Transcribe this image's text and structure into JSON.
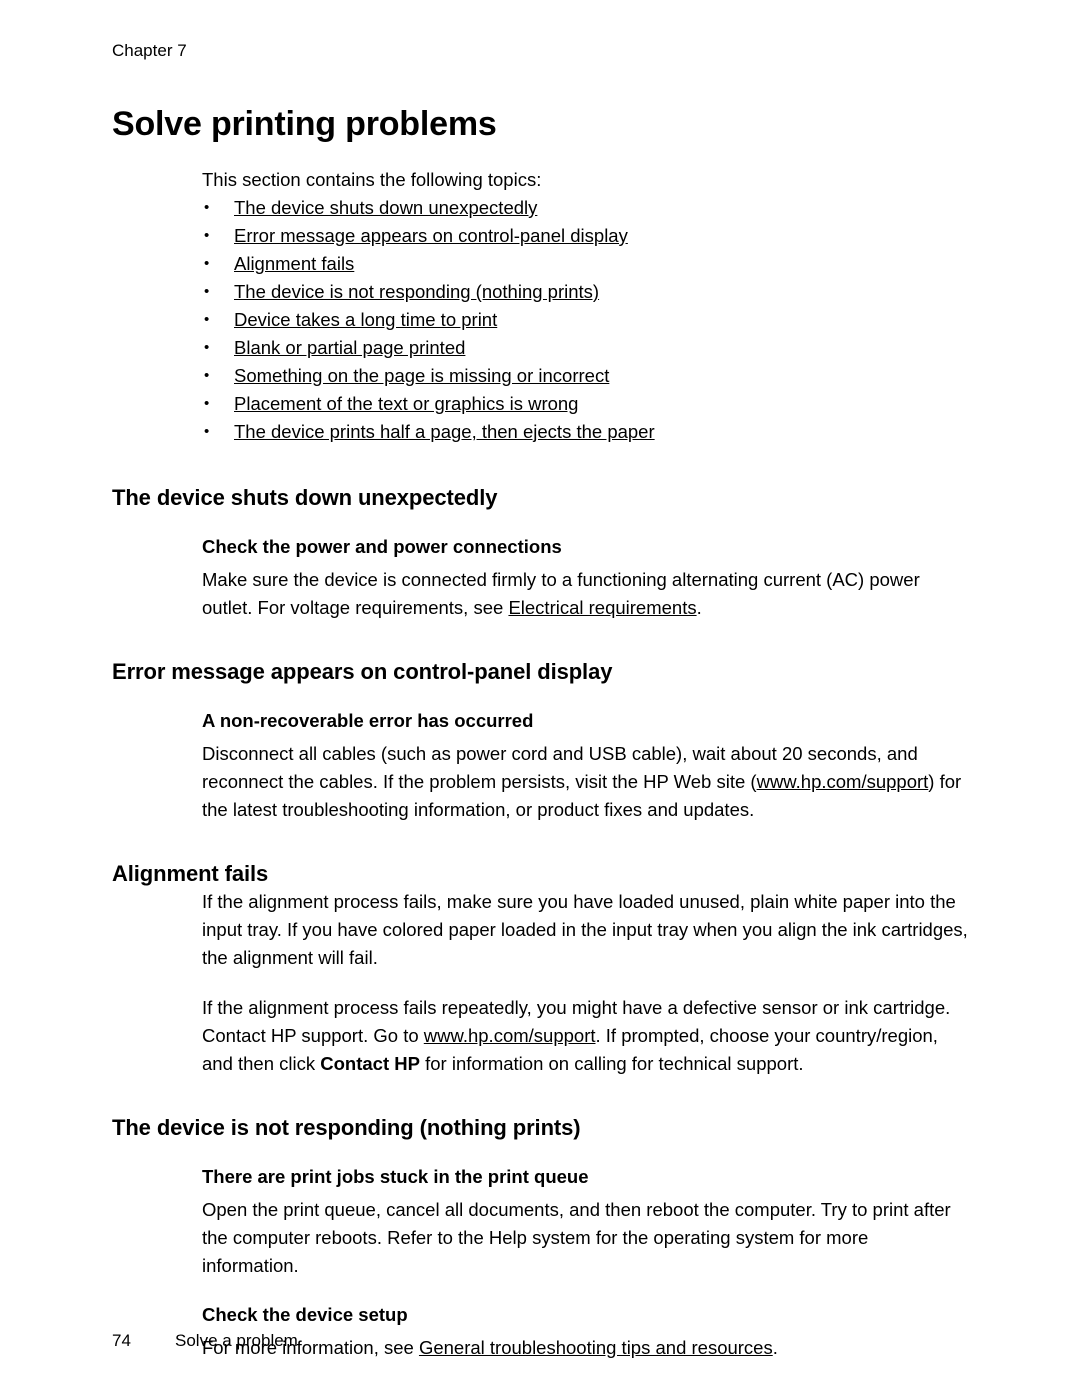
{
  "header": {
    "running_head": "Chapter 7"
  },
  "page": {
    "title": "Solve printing problems",
    "intro": "This section contains the following topics:"
  },
  "toc": {
    "items": [
      "The device shuts down unexpectedly",
      "Error message appears on control-panel display",
      "Alignment fails",
      "The device is not responding (nothing prints)",
      "Device takes a long time to print",
      "Blank or partial page printed",
      "Something on the page is missing or incorrect",
      "Placement of the text or graphics is wrong",
      "The device prints half a page, then ejects the paper"
    ]
  },
  "sections": [
    {
      "heading": "The device shuts down unexpectedly",
      "sub_heading": "Check the power and power connections",
      "para_1_a": "Make sure the device is connected firmly to a functioning alternating current (AC) power outlet. For voltage requirements, see ",
      "para_1_link": "Electrical requirements",
      "para_1_b": "."
    },
    {
      "heading": "Error message appears on control-panel display",
      "sub_heading": "A non-recoverable error has occurred",
      "para_1_a": "Disconnect all cables (such as power cord and USB cable), wait about 20 seconds, and reconnect the cables. If the problem persists, visit the HP Web site (",
      "para_1_link": "www.hp.com/support",
      "para_1_b": ") for the latest troubleshooting information, or product fixes and updates."
    },
    {
      "heading": "Alignment fails",
      "para_1": "If the alignment process fails, make sure you have loaded unused, plain white paper into the input tray. If you have colored paper loaded in the input tray when you align the ink cartridges, the alignment will fail.",
      "para_2_a": "If the alignment process fails repeatedly, you might have a defective sensor or ink cartridge. Contact HP support. Go to ",
      "para_2_link": "www.hp.com/support",
      "para_2_b": ". If prompted, choose your country/region, and then click ",
      "para_2_bold": "Contact HP",
      "para_2_c": " for information on calling for technical support."
    },
    {
      "heading": "The device is not responding (nothing prints)",
      "sub_heading_1": "There are print jobs stuck in the print queue",
      "para_1": "Open the print queue, cancel all documents, and then reboot the computer. Try to print after the computer reboots. Refer to the Help system for the operating system for more information.",
      "sub_heading_2": "Check the device setup",
      "para_2_a": "For more information, see ",
      "para_2_link": "General troubleshooting tips and resources",
      "para_2_b": "."
    }
  ],
  "footer": {
    "page_number": "74",
    "section_name": "Solve a problem"
  }
}
